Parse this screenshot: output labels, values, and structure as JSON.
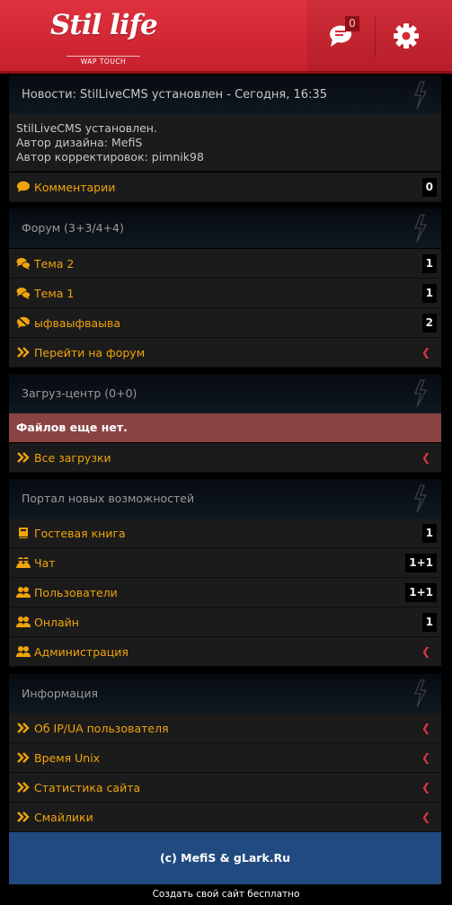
{
  "header": {
    "logo_text": "Stil life",
    "logo_sub": "WAP TOUCH",
    "chat_count": "0"
  },
  "news": {
    "title": "Новости: StilLiveCMS установлен - Сегодня, 16:35",
    "lines": [
      "StilLiveCMS установлен.",
      "Автор дизайна: MefiS",
      "Автор корректировок: pimnik98"
    ],
    "comments_label": "Комментарии",
    "comments_count": "0"
  },
  "forum": {
    "title": "Форум (3+3/4+4)",
    "topics": [
      {
        "label": "Тема 2",
        "count": "1"
      },
      {
        "label": "Тема 1",
        "count": "1"
      },
      {
        "label": "ыфваыфваыва",
        "count": "2"
      }
    ],
    "goto_label": "Перейти на форум"
  },
  "downloads": {
    "title": "Загруз-центр (0+0)",
    "empty_text": "Файлов еще нет.",
    "all_label": "Все загрузки"
  },
  "portal": {
    "title": "Портал новых возможностей",
    "items": [
      {
        "label": "Гостевая книга",
        "count": "1"
      },
      {
        "label": "Чат",
        "count": "1+1"
      },
      {
        "label": "Пользователи",
        "count": "1+1"
      },
      {
        "label": "Онлайн",
        "count": "1"
      },
      {
        "label": "Администрация"
      }
    ]
  },
  "info": {
    "title": "Информация",
    "items": [
      {
        "label": "Об IP/UA пользователя"
      },
      {
        "label": "Время Unix"
      },
      {
        "label": "Статистика сайта"
      },
      {
        "label": "Смайлики"
      }
    ]
  },
  "footer": {
    "copyright": "(c) MefiS & gLark.Ru",
    "create_link": "Создать свой сайт бесплатно"
  },
  "colors": {
    "header_red": "#d42a35",
    "link_orange": "#f0a40b",
    "arrow_red": "#e0353f",
    "empty_bg": "#8a4343",
    "footer_blue": "#214b80"
  }
}
